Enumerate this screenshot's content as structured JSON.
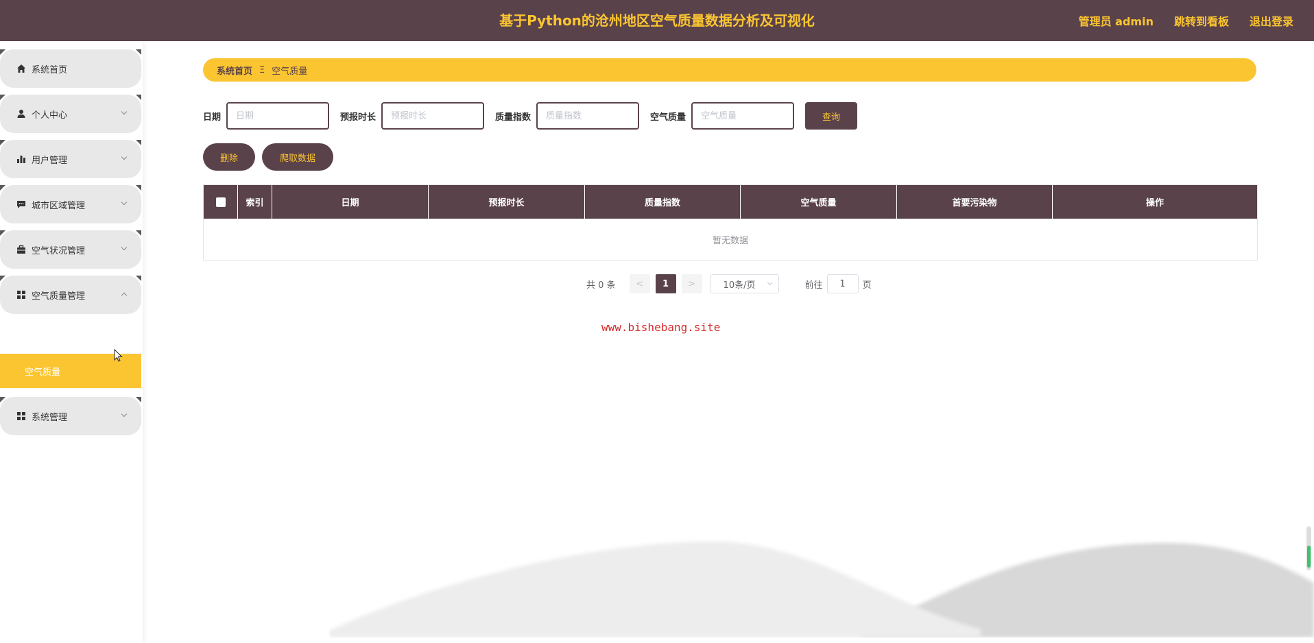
{
  "header": {
    "title": "基于Python的沧州地区空气质量数据分析及可视化",
    "admin_label": "管理员 admin",
    "dashboard_link": "跳转到看板",
    "logout_link": "退出登录"
  },
  "sidebar": {
    "items": [
      {
        "label": "系统首页",
        "icon": "home-icon"
      },
      {
        "label": "个人中心",
        "icon": "user-icon"
      },
      {
        "label": "用户管理",
        "icon": "bar-chart-icon"
      },
      {
        "label": "城市区域管理",
        "icon": "message-icon"
      },
      {
        "label": "空气状况管理",
        "icon": "briefcase-icon"
      },
      {
        "label": "空气质量管理",
        "icon": "grid-icon"
      },
      {
        "label": "系统管理",
        "icon": "grid-icon"
      }
    ],
    "active_sub": "空气质量"
  },
  "breadcrumb": {
    "home": "系统首页",
    "separator": "Ξ",
    "current": "空气质量"
  },
  "filters": {
    "date_label": "日期",
    "date_placeholder": "日期",
    "forecast_label": "预报时长",
    "forecast_placeholder": "预报时长",
    "index_label": "质量指数",
    "index_placeholder": "质量指数",
    "quality_label": "空气质量",
    "quality_placeholder": "空气质量",
    "query_button": "查询"
  },
  "actions": {
    "delete_button": "删除",
    "crawl_button": "爬取数据"
  },
  "table": {
    "columns": [
      "索引",
      "日期",
      "预报时长",
      "质量指数",
      "空气质量",
      "首要污染物",
      "操作"
    ],
    "empty_text": "暂无数据"
  },
  "pagination": {
    "total": "共 0 条",
    "prev": "<",
    "page": "1",
    "next": ">",
    "page_size": "10条/页",
    "goto_label": "前往",
    "goto_value": "1",
    "page_suffix": "页"
  },
  "watermark": "www.bishebang.site",
  "colors": {
    "primary": "#5a424b",
    "accent": "#fbc531"
  }
}
